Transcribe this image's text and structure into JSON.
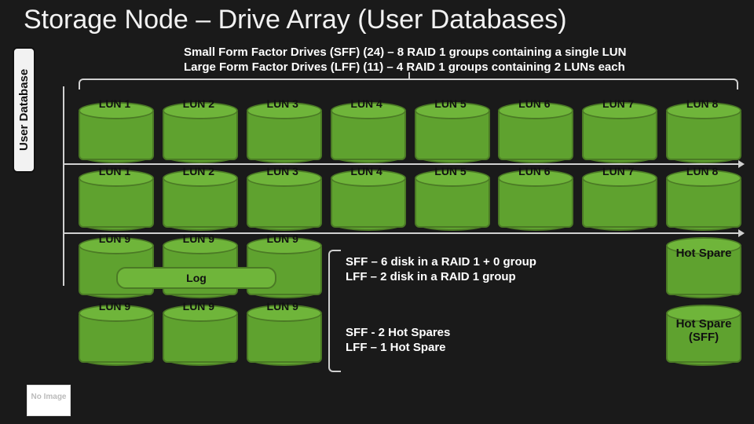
{
  "title": "Storage Node – Drive Array (User Databases)",
  "subtitle_line1": "Small Form Factor Drives (SFF) (24) – 8 RAID 1 groups containing a single LUN",
  "subtitle_line2": "Large Form Factor Drives (LFF) (11) – 4 RAID 1 groups containing 2 LUNs each",
  "ylabel": "User Database",
  "rows": {
    "r0": [
      "LUN 1",
      "LUN 2",
      "LUN 3",
      "LUN 4",
      "LUN 5",
      "LUN 6",
      "LUN 7",
      "LUN 8"
    ],
    "r1": [
      "LUN 1",
      "LUN 2",
      "LUN 3",
      "LUN 4",
      "LUN 5",
      "LUN 6",
      "LUN 7",
      "LUN 8"
    ],
    "r2": [
      "LUN 9",
      "LUN 9",
      "LUN 9"
    ],
    "r3": [
      "LUN 9",
      "LUN 9",
      "LUN 9"
    ]
  },
  "log_label": "Log",
  "note1_line1": "SFF – 6 disk in a RAID 1 + 0  group",
  "note1_line2": "LFF – 2 disk in a RAID 1 group",
  "note2_line1": "SFF - 2 Hot Spares",
  "note2_line2": "LFF – 1 Hot Spare",
  "spare1": "Hot Spare",
  "spare2_line1": "Hot Spare",
  "spare2_line2": "(SFF)",
  "noimg": "No Image",
  "colors": {
    "cylinder": "#5fa22f",
    "cylinder_top": "#6fb53a",
    "bg": "#1a1a1a"
  }
}
